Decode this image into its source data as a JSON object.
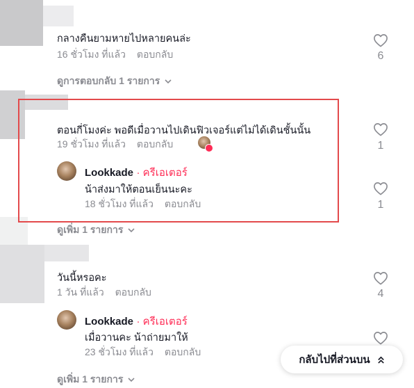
{
  "threads": [
    {
      "text": "กลางคืนยามหายไปหลายคนล่ะ",
      "time": "16 ชั่วโมง ที่แล้ว",
      "reply_label": "ตอบกลับ",
      "likes": "6",
      "view_more": "ดูการตอบกลับ 1 รายการ"
    },
    {
      "text": "ตอนกี่โมงค่ะ พอดีเมื่อวานไปเดินฟิวเจอร์แต่ไม่ได้เดินชั้นนั้น",
      "time": "19 ชั่วโมง ที่แล้ว",
      "reply_label": "ตอบกลับ",
      "likes": "1",
      "reply": {
        "username": "Lookkade",
        "creator_badge": "· ครีเอเตอร์",
        "text": "น้าส่งมาให้ตอนเย็นนะคะ",
        "time": "18 ชั่วโมง ที่แล้ว",
        "reply_label": "ตอบกลับ",
        "likes": "1"
      },
      "view_more": "ดูเพิ่ม 1 รายการ"
    },
    {
      "text": "วันนี้หรอคะ",
      "time": "1 วัน ที่แล้ว",
      "reply_label": "ตอบกลับ",
      "likes": "4",
      "reply": {
        "username": "Lookkade",
        "creator_badge": "· ครีเอเตอร์",
        "text": "เมื่อวานคะ น้าถ่ายมาให้",
        "time": "23 ชั่วโมง ที่แล้ว",
        "reply_label": "ตอบกลับ"
      },
      "view_more": "ดูเพิ่ม 1 รายการ"
    }
  ],
  "back_to_top": "กลับไปที่ส่วนบน",
  "colors": {
    "accent": "#fe2c55",
    "highlight_box": "#e3494b",
    "meta": "#8a8b91"
  }
}
